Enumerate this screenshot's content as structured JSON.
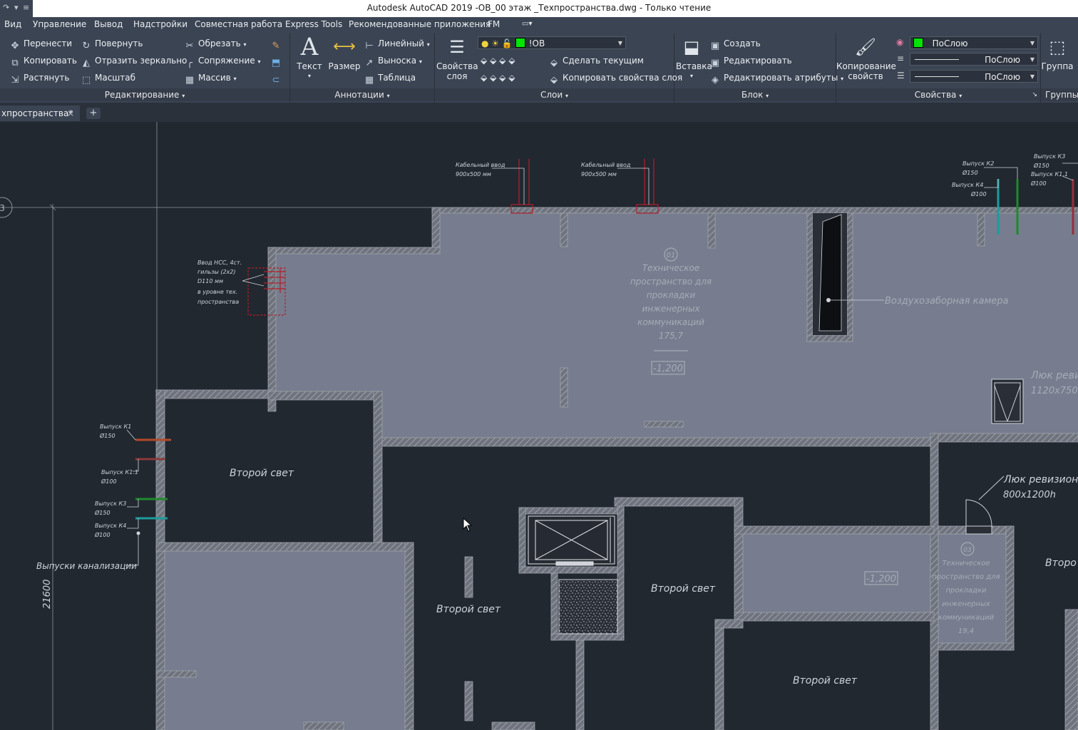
{
  "window": {
    "title": "Autodesk AutoCAD 2019    -ОВ_00 этаж _Техпространства.dwg - Только чтение"
  },
  "menu": [
    "Вид",
    "Управление",
    "Вывод",
    "Надстройки",
    "Совместная работа",
    "Express Tools",
    "Рекомендованные приложения",
    "FM"
  ],
  "ribbon": {
    "edit": {
      "title": "Редактирование",
      "buttons": [
        "Перенести",
        "Повернуть",
        "Обрезать",
        "Копировать",
        "Отразить зеркально",
        "Сопряжение",
        "Растянуть",
        "Масштаб",
        "Массив"
      ]
    },
    "annotation": {
      "title": "Аннотации",
      "text": "Текст",
      "dimension": "Размер",
      "linear": "Линейный",
      "leader": "Выноска",
      "table": "Таблица"
    },
    "layers": {
      "title": "Слои",
      "props_line1": "Свойства",
      "props_line2": "слоя",
      "current_layer": "!ОВ",
      "make_current": "Сделать текущим",
      "copy_props": "Копировать свойства слоя"
    },
    "block": {
      "title": "Блок",
      "insert": "Вставка",
      "create": "Создать",
      "edit": "Редактировать",
      "edit_attrs": "Редактировать атрибуты"
    },
    "properties": {
      "title": "Свойства",
      "match_line1": "Копирование",
      "match_line2": "свойств",
      "color": "ПоСлою",
      "linetype": "ПоСлою",
      "lineweight": "ПоСлою"
    },
    "groups": {
      "title": "Группы",
      "group": "Группа"
    }
  },
  "tabs": {
    "active": "хпространства*"
  },
  "drawing": {
    "grid_marker": "3",
    "dim_vertical": "21600",
    "cable1_l1": "Кабельный ввод",
    "cable1_l2": "900х500 мм",
    "cable2_l1": "Кабельный ввод",
    "cable2_l2": "900х500 мм",
    "outlet_k2": "Выпуск К2",
    "outlet_k2_d": "Ø150",
    "outlet_k4": "Выпуск К4",
    "outlet_k4_d": "Ø100",
    "outlet_k3": "Выпуск К3",
    "outlet_k3_d": "Ø150",
    "outlet_k11": "Выпуск К1.1",
    "outlet_k11_d": "Ø100",
    "water_l1": "Ввод НСС, 4ст.",
    "water_l2": "гильзы (2х2)",
    "water_l3": "D110 мм",
    "water_l4": "в уровне тех.",
    "water_l5": "пространства",
    "room1_num": "01",
    "room1_l1": "Техническое",
    "room1_l2": "пространство для",
    "room1_l3": "прокладки",
    "room1_l4": "инженерных",
    "room1_l5": "коммуникаций",
    "room1_area": "175,7",
    "level1": "-1,200",
    "air_chamber": "Воздухозаборная камера",
    "hatch1_l1": "Люк реви",
    "hatch1_l2": "1120х750",
    "left_k1": "Выпуск К1",
    "left_k1_d": "Ø150",
    "left_k11": "Выпуск К1.1",
    "left_k11_d": "Ø100",
    "left_k3": "Выпуск К3",
    "left_k3_d": "Ø150",
    "left_k4": "Выпуск К4",
    "left_k4_d": "Ø100",
    "sewer_outlets": "Выпуски канализации",
    "second_light_1": "Второй свет",
    "second_light_2": "Второй свет",
    "second_light_3": "Второй свет",
    "second_light_4": "Второй свет",
    "second_light_5": "Второ",
    "hatch2_l1": "Люк ревизионн",
    "hatch2_l2": "800х1200h",
    "room3_num": "03",
    "room3_l1": "Техническое",
    "room3_l2": "пространство для",
    "room3_l3": "прокладки",
    "room3_l4": "инженерных",
    "room3_l5": "коммуникаций",
    "room3_area": "19,4",
    "level3": "-1,200"
  },
  "colors": {
    "canvas": "#212830",
    "room_fill": "#777d8e",
    "wall": "#8b8f99",
    "cad_text": "#cfd3db",
    "red": "#b3202a",
    "green": "#1f8a2b",
    "teal": "#1e9c9c",
    "brown": "#8a3a2a",
    "crimson": "#9c2d3a",
    "layer_swatch": "#00e600"
  }
}
